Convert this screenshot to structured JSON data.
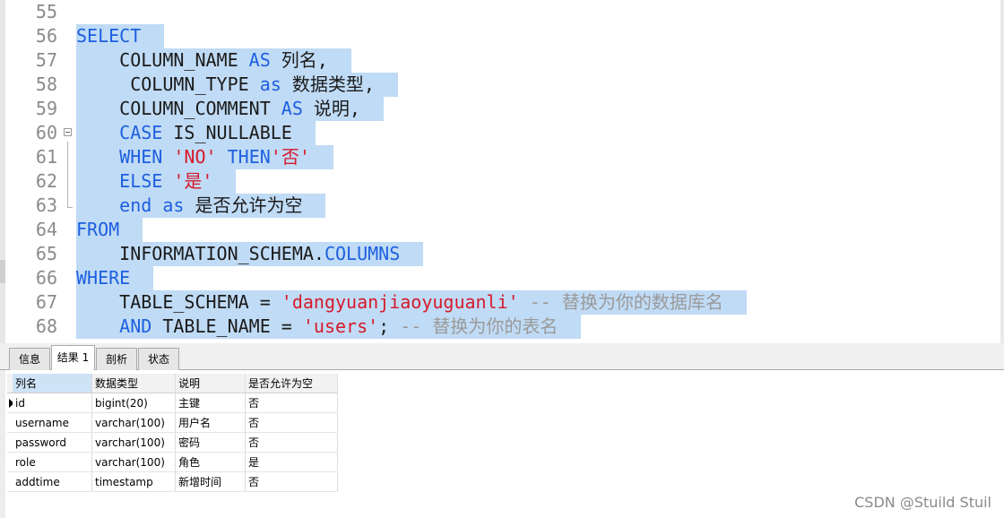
{
  "editor": {
    "lines": [
      {
        "num": "55",
        "parts": []
      },
      {
        "num": "56",
        "parts": [
          {
            "t": "SELECT",
            "k": "kw"
          }
        ]
      },
      {
        "num": "57",
        "parts": [
          {
            "t": "    COLUMN_NAME ",
            "k": "plain"
          },
          {
            "t": "AS",
            "k": "kw"
          },
          {
            "t": " 列名,",
            "k": "plain"
          }
        ]
      },
      {
        "num": "58",
        "parts": [
          {
            "t": "     COLUMN_TYPE ",
            "k": "plain"
          },
          {
            "t": "as",
            "k": "kw"
          },
          {
            "t": " 数据类型,",
            "k": "plain"
          }
        ]
      },
      {
        "num": "59",
        "parts": [
          {
            "t": "    COLUMN_COMMENT ",
            "k": "plain"
          },
          {
            "t": "AS",
            "k": "kw"
          },
          {
            "t": " 说明,",
            "k": "plain"
          }
        ]
      },
      {
        "num": "60",
        "parts": [
          {
            "t": "    ",
            "k": "plain"
          },
          {
            "t": "CASE",
            "k": "kw"
          },
          {
            "t": " IS_NULLABLE",
            "k": "plain"
          }
        ]
      },
      {
        "num": "61",
        "parts": [
          {
            "t": "    ",
            "k": "plain"
          },
          {
            "t": "WHEN",
            "k": "kw"
          },
          {
            "t": " ",
            "k": "plain"
          },
          {
            "t": "'NO'",
            "k": "str"
          },
          {
            "t": " ",
            "k": "plain"
          },
          {
            "t": "THEN",
            "k": "kw"
          },
          {
            "t": "'否'",
            "k": "str"
          }
        ]
      },
      {
        "num": "62",
        "parts": [
          {
            "t": "    ",
            "k": "plain"
          },
          {
            "t": "ELSE",
            "k": "kw"
          },
          {
            "t": " ",
            "k": "plain"
          },
          {
            "t": "'是'",
            "k": "str"
          }
        ]
      },
      {
        "num": "63",
        "parts": [
          {
            "t": "    ",
            "k": "plain"
          },
          {
            "t": "end",
            "k": "kw"
          },
          {
            "t": " ",
            "k": "plain"
          },
          {
            "t": "as",
            "k": "kw"
          },
          {
            "t": " 是否允许为空",
            "k": "plain"
          }
        ]
      },
      {
        "num": "64",
        "parts": [
          {
            "t": "FROM",
            "k": "kw"
          }
        ]
      },
      {
        "num": "65",
        "parts": [
          {
            "t": "    INFORMATION_SCHEMA.",
            "k": "plain"
          },
          {
            "t": "COLUMNS",
            "k": "kw"
          }
        ]
      },
      {
        "num": "66",
        "parts": [
          {
            "t": "WHERE",
            "k": "kw"
          }
        ]
      },
      {
        "num": "67",
        "parts": [
          {
            "t": "    TABLE_SCHEMA = ",
            "k": "plain"
          },
          {
            "t": "'dangyuanjiaoyuguanli'",
            "k": "str"
          },
          {
            "t": " -- 替换为你的数据库名",
            "k": "cmt"
          }
        ]
      },
      {
        "num": "68",
        "parts": [
          {
            "t": "    ",
            "k": "plain"
          },
          {
            "t": "AND",
            "k": "kw"
          },
          {
            "t": " TABLE_NAME = ",
            "k": "plain"
          },
          {
            "t": "'users'",
            "k": "str"
          },
          {
            "t": "; ",
            "k": "plain"
          },
          {
            "t": "-- 替换为你的表名",
            "k": "cmt"
          }
        ]
      }
    ]
  },
  "tabs": [
    {
      "label": "信息",
      "active": false
    },
    {
      "label": "结果 1",
      "active": true
    },
    {
      "label": "剖析",
      "active": false
    },
    {
      "label": "状态",
      "active": false
    }
  ],
  "results": {
    "columns": [
      "列名",
      "数据类型",
      "说明",
      "是否允许为空"
    ],
    "rows": [
      [
        "id",
        "bigint(20)",
        "主键",
        "否"
      ],
      [
        "username",
        "varchar(100)",
        "用户名",
        "否"
      ],
      [
        "password",
        "varchar(100)",
        "密码",
        "否"
      ],
      [
        "role",
        "varchar(100)",
        "角色",
        "是"
      ],
      [
        "addtime",
        "timestamp",
        "新增时间",
        "否"
      ]
    ],
    "current_row": 0
  },
  "watermark": "CSDN @Stuild Stuil",
  "colors": {
    "selection": "#c0dbf5",
    "keyword": "#1c5fe0",
    "string": "#d61a2b",
    "comment": "#9a9a9a"
  }
}
